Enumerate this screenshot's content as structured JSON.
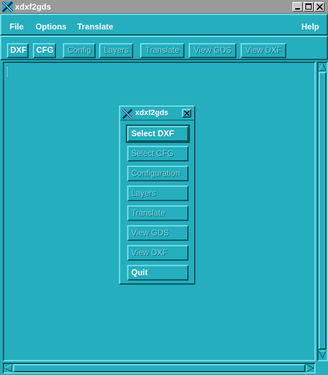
{
  "window": {
    "title": "xdxf2gds"
  },
  "menubar": {
    "file": "File",
    "options": "Options",
    "translate": "Translate",
    "help": "Help"
  },
  "toolbar": {
    "buttons": [
      {
        "label": "DXF",
        "enabled": true
      },
      {
        "label": "CFG",
        "enabled": true
      },
      {
        "label": "Config",
        "enabled": false
      },
      {
        "label": "Layers",
        "enabled": false
      },
      {
        "label": "Translate",
        "enabled": false
      },
      {
        "label": "View GDS",
        "enabled": false
      },
      {
        "label": "View DXF",
        "enabled": false
      }
    ]
  },
  "dialog": {
    "title": "xdxf2gds",
    "buttons": [
      {
        "label": "Select DXF",
        "enabled": true
      },
      {
        "label": "Select CFG",
        "enabled": false
      },
      {
        "label": "Configuration",
        "enabled": false
      },
      {
        "label": "Layers",
        "enabled": false
      },
      {
        "label": "Translate",
        "enabled": false
      },
      {
        "label": "View GDS",
        "enabled": false
      },
      {
        "label": "View DXF",
        "enabled": false
      },
      {
        "label": "Quit",
        "enabled": true
      }
    ]
  },
  "colors": {
    "background": "#25aebe",
    "titlebar": "#9a9a9a",
    "text": "#ffffff"
  }
}
